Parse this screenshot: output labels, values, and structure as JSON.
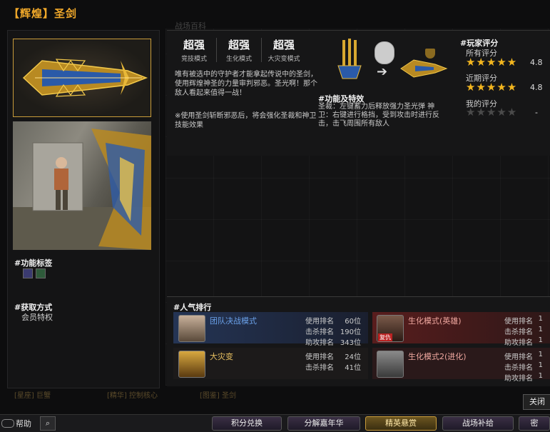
{
  "title": "【辉煌】圣剑",
  "modes": [
    {
      "rating": "超强",
      "name": "竞技模式"
    },
    {
      "rating": "超强",
      "name": "生化模式"
    },
    {
      "rating": "超强",
      "name": "大灾变模式"
    }
  ],
  "description": "唯有被选中的守护者才能拿起传说中的圣剑，使用辉煌神圣的力量审判邪恶。圣光啊！那个敌人看起来值得一战！",
  "note": "※使用圣剑斩断邪恶后，将会强化圣裁和神卫技能效果",
  "function": {
    "heading": "#功能及特效",
    "text": "圣裁：左键蓄力后释放强力圣光弹 神卫：右键进行格挡，受到攻击时进行反击，击飞周围所有敌人"
  },
  "ratings": {
    "heading": "#玩家评分",
    "all": {
      "label": "所有评分",
      "stars": 5,
      "score": "4.8"
    },
    "recent": {
      "label": "近期评分",
      "stars": 5,
      "score": "4.8"
    },
    "mine": {
      "label": "我的评分",
      "stars": 0,
      "score": "-"
    }
  },
  "tags": {
    "heading": "#功能标签"
  },
  "obtain": {
    "heading": "#获取方式",
    "value": "会员特权"
  },
  "ranking": {
    "heading": "#人气排行",
    "cards": [
      {
        "mode": "团队决战模式",
        "stats": [
          [
            "使用排名",
            "60位"
          ],
          [
            "击杀排名",
            "190位"
          ],
          [
            "助攻排名",
            "343位"
          ]
        ]
      },
      {
        "mode": "生化模式(英雄)",
        "badge": "复仇",
        "stats": [
          [
            "使用排名",
            "1"
          ],
          [
            "击杀排名",
            "1"
          ],
          [
            "助攻排名",
            "1"
          ]
        ]
      },
      {
        "mode": "大灾变",
        "stats": [
          [
            "使用排名",
            "24位"
          ],
          [
            "击杀排名",
            "41位"
          ]
        ]
      },
      {
        "mode": "生化模式2(进化)",
        "stats": [
          [
            "使用排名",
            "1"
          ],
          [
            "击杀排名",
            "1"
          ],
          [
            "助攻排名",
            "1"
          ]
        ]
      }
    ]
  },
  "close_label": "关闭",
  "help_label": "帮助",
  "bottom_tabs": [
    "积分兑换",
    "分解嘉年华",
    "精英悬赏",
    "战场补给",
    "密"
  ],
  "bg_text": [
    "战场百科",
    "[星座] 巨蟹",
    "[精华] 控制核心",
    "[图鉴] 圣剑"
  ],
  "colors": {
    "accent": "#f0a82a",
    "star": "#f3b61f"
  }
}
